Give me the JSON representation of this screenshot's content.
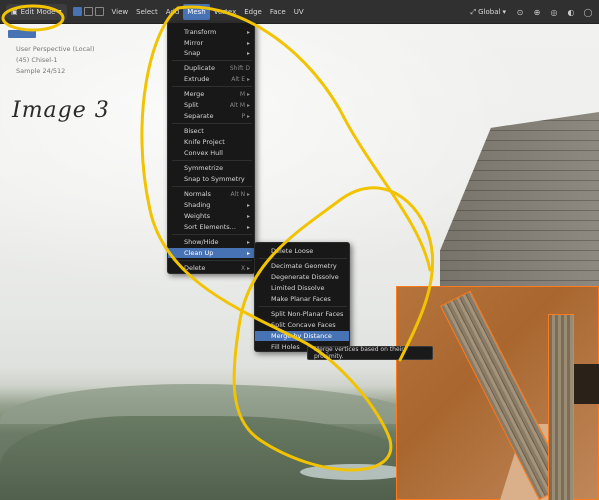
{
  "header": {
    "mode": "Edit Mode",
    "menus": [
      "View",
      "Select",
      "Add",
      "Mesh",
      "Vertex",
      "Edge",
      "Face",
      "UV"
    ],
    "orientation": "Global"
  },
  "viewport": {
    "info_lines": [
      "User Perspective (Local)",
      "(45) Chisel-1",
      "Sample 24/512"
    ],
    "handwritten_label": "Image 3"
  },
  "mesh_menu": {
    "items": [
      {
        "label": "Transform",
        "shortcut": "",
        "submenu": true
      },
      {
        "label": "Mirror",
        "shortcut": "",
        "submenu": true
      },
      {
        "label": "Snap",
        "shortcut": "",
        "submenu": true
      },
      {
        "label": "Duplicate",
        "shortcut": "Shift D",
        "submenu": false
      },
      {
        "label": "Extrude",
        "shortcut": "Alt E",
        "submenu": true
      },
      {
        "label": "Merge",
        "shortcut": "M",
        "submenu": true
      },
      {
        "label": "Split",
        "shortcut": "Alt M",
        "submenu": true
      },
      {
        "label": "Separate",
        "shortcut": "P",
        "submenu": true
      },
      {
        "label": "Bisect",
        "shortcut": "",
        "submenu": false
      },
      {
        "label": "Knife Project",
        "shortcut": "",
        "submenu": false
      },
      {
        "label": "Convex Hull",
        "shortcut": "",
        "submenu": false
      },
      {
        "label": "Symmetrize",
        "shortcut": "",
        "submenu": false
      },
      {
        "label": "Snap to Symmetry",
        "shortcut": "",
        "submenu": false
      },
      {
        "label": "Normals",
        "shortcut": "Alt N",
        "submenu": true
      },
      {
        "label": "Shading",
        "shortcut": "",
        "submenu": true
      },
      {
        "label": "Weights",
        "shortcut": "",
        "submenu": true
      },
      {
        "label": "Sort Elements...",
        "shortcut": "",
        "submenu": true
      },
      {
        "label": "Show/Hide",
        "shortcut": "",
        "submenu": true
      },
      {
        "label": "Clean Up",
        "shortcut": "",
        "submenu": true
      },
      {
        "label": "Delete",
        "shortcut": "X",
        "submenu": true
      }
    ]
  },
  "cleanup_menu": {
    "items": [
      "Delete Loose",
      "Decimate Geometry",
      "Degenerate Dissolve",
      "Limited Dissolve",
      "Make Planar Faces",
      "Split Non-Planar Faces",
      "Split Concave Faces",
      "Merge by Distance",
      "Fill Holes"
    ],
    "highlighted": "Merge by Distance"
  },
  "tooltip": "Merge vertices based on their proximity.",
  "colors": {
    "accent": "#4772b3",
    "annotation": "#f2c300",
    "selection": "#ff7a1c"
  }
}
